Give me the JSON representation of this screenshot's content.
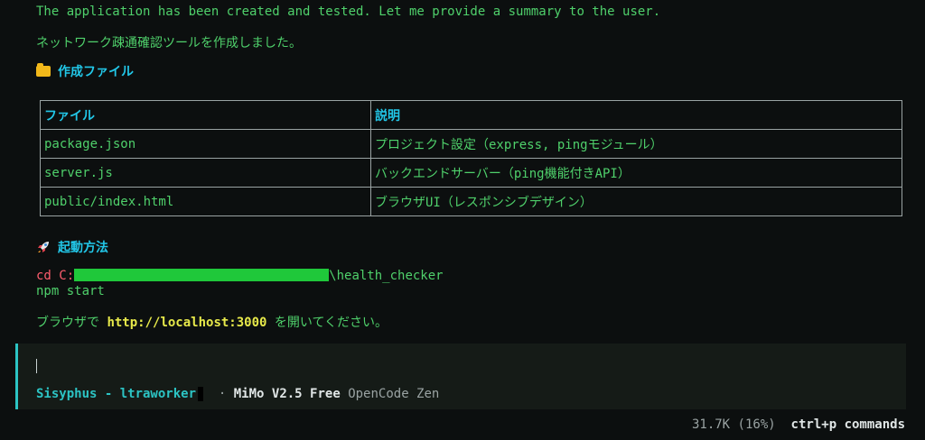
{
  "log": {
    "thinking": "The application has been created and tested. Let me provide a summary to the user.",
    "summary": "ネットワーク疎通確認ツールを作成しました。"
  },
  "section_files": {
    "icon": "folder-icon",
    "title": "作成ファイル",
    "headers": [
      "ファイル",
      "説明"
    ],
    "rows": [
      {
        "file": "package.json",
        "desc": "プロジェクト設定（express, pingモジュール）"
      },
      {
        "file": "server.js",
        "desc": "バックエンドサーバー（ping機能付きAPI）"
      },
      {
        "file": "public/index.html",
        "desc": "ブラウザUI（レスポンシブデザイン）"
      }
    ]
  },
  "section_run": {
    "icon": "rocket-icon",
    "title": "起動方法",
    "cmd_cd": "cd",
    "cmd_path_prefix": "C:",
    "cmd_path_suffix": "\\health_checker",
    "cmd_npm": "npm start",
    "open_prefix": "ブラウザで ",
    "url": "http://localhost:3000",
    "open_suffix": " を開いてください。"
  },
  "input": {
    "agent": "Sisyphus - ltraworker",
    "separator": "·",
    "model": "MiMo V2.5 Free",
    "provider": "OpenCode Zen"
  },
  "footer": {
    "usage": "31.7K (16%)",
    "key": "ctrl+p",
    "key_label": "commands"
  }
}
